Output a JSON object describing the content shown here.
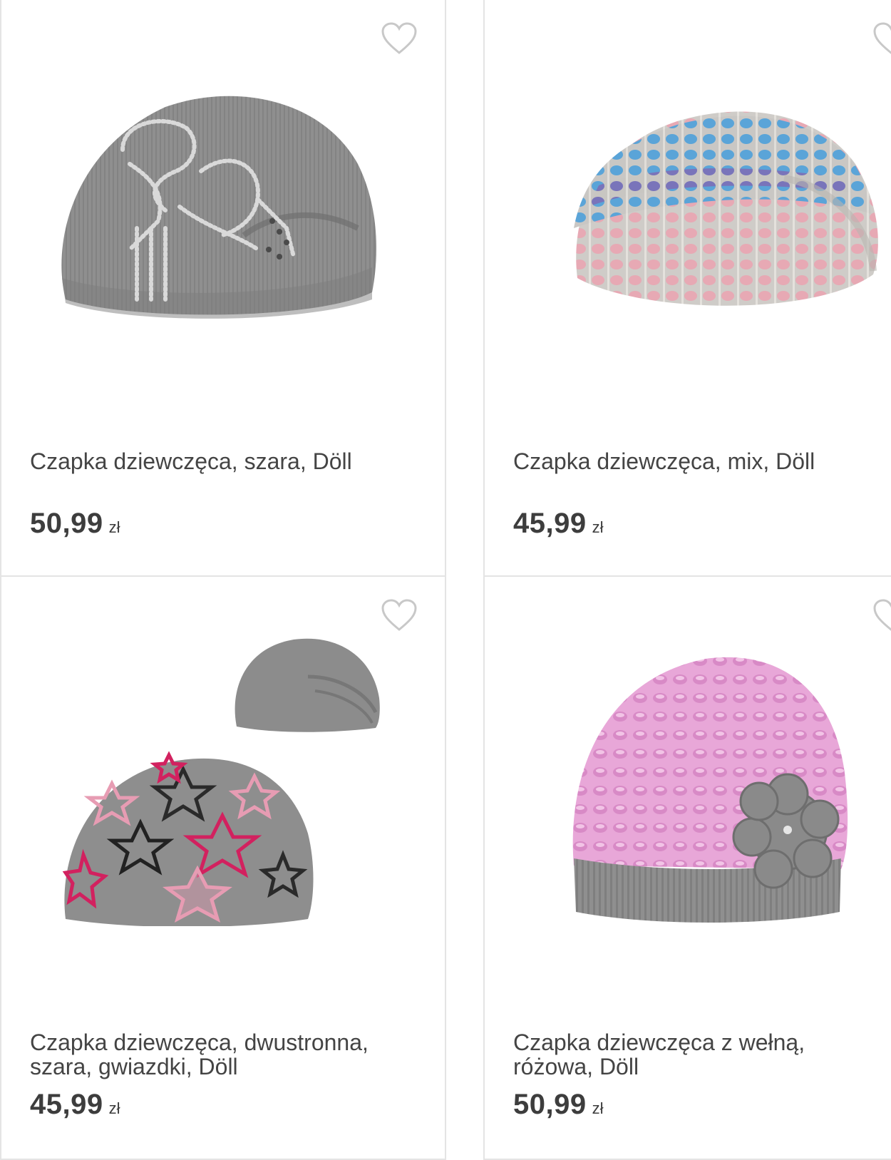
{
  "colors": {
    "border": "#e4e4e4",
    "text": "#444444",
    "heart": "#c8c8c8"
  },
  "products": [
    {
      "title": "Czapka dziewczęca, szara, Döll",
      "price": "50,99",
      "currency": "zł",
      "image_icon": "grey-beanie-rhinestone-image",
      "favorite_icon": "heart-outline-icon"
    },
    {
      "title": "Czapka dziewczęca, mix, Döll",
      "price": "45,99",
      "currency": "zł",
      "image_icon": "multicolor-knit-beanie-image",
      "favorite_icon": "heart-outline-icon"
    },
    {
      "title": "Czapka dziewczęca, dwustronna, szara, gwiazdki, Döll",
      "price": "45,99",
      "currency": "zł",
      "image_icon": "reversible-star-beanie-image",
      "favorite_icon": "heart-outline-icon"
    },
    {
      "title": "Czapka dziewczęca z wełną, różowa, Döll",
      "price": "50,99",
      "currency": "zł",
      "image_icon": "pink-wool-hat-flower-image",
      "favorite_icon": "heart-outline-icon"
    }
  ]
}
